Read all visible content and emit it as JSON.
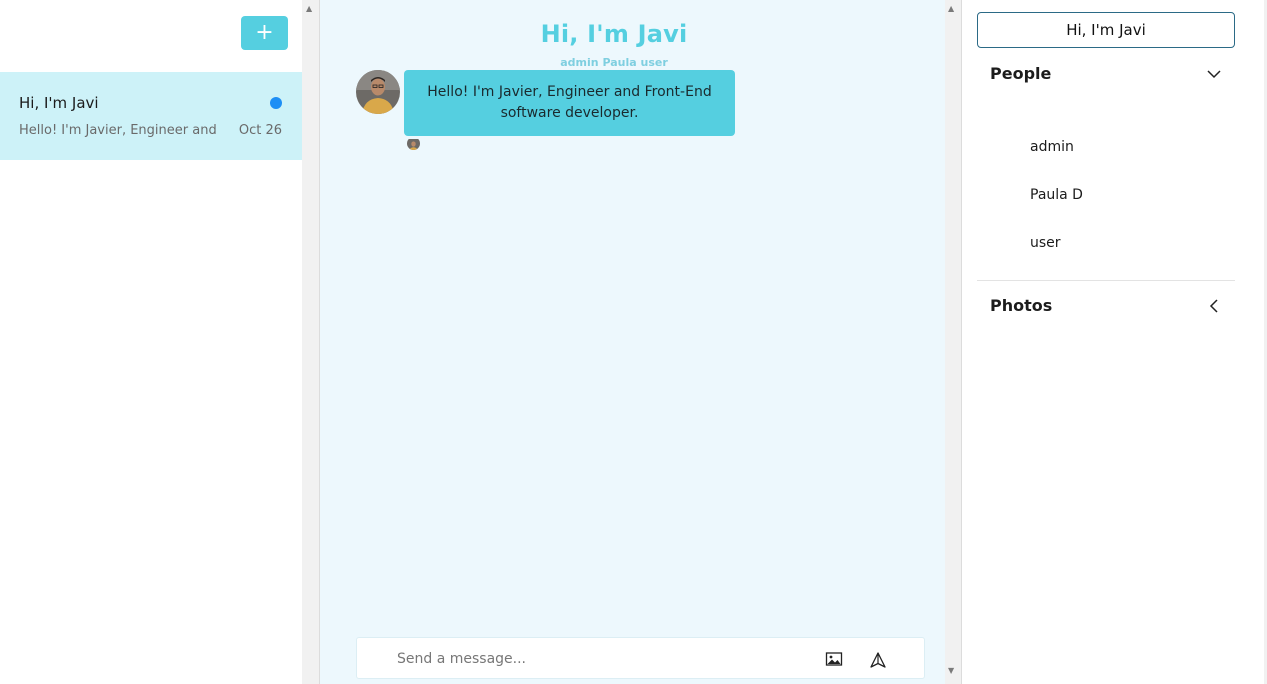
{
  "sidebar": {
    "new_chat_label": "+",
    "chats": [
      {
        "title": "Hi, I'm Javi",
        "preview": "Hello! I'm Javier, Engineer and Front-End software developer.",
        "date": "Oct 26",
        "unread": true
      }
    ]
  },
  "chat": {
    "title": "Hi, I'm Javi",
    "members": "admin Paula user",
    "messages": [
      {
        "text": "Hello! I'm Javier, Engineer and Front-End software developer.",
        "avatar": "user-avatar-photo"
      }
    ],
    "composer": {
      "placeholder": "Send a message...",
      "value": "",
      "image_icon": "image-icon",
      "send_icon": "send-icon"
    }
  },
  "settings": {
    "chat_name": "Hi, I'm Javi",
    "people_label": "People",
    "people": [
      "admin",
      "Paula D",
      "user"
    ],
    "photos_label": "Photos"
  },
  "colors": {
    "accent": "#55cfe0",
    "active_chat_bg": "#cdf2f8",
    "chat_bg": "#edf8fd",
    "unread": "#1e8ff5"
  }
}
